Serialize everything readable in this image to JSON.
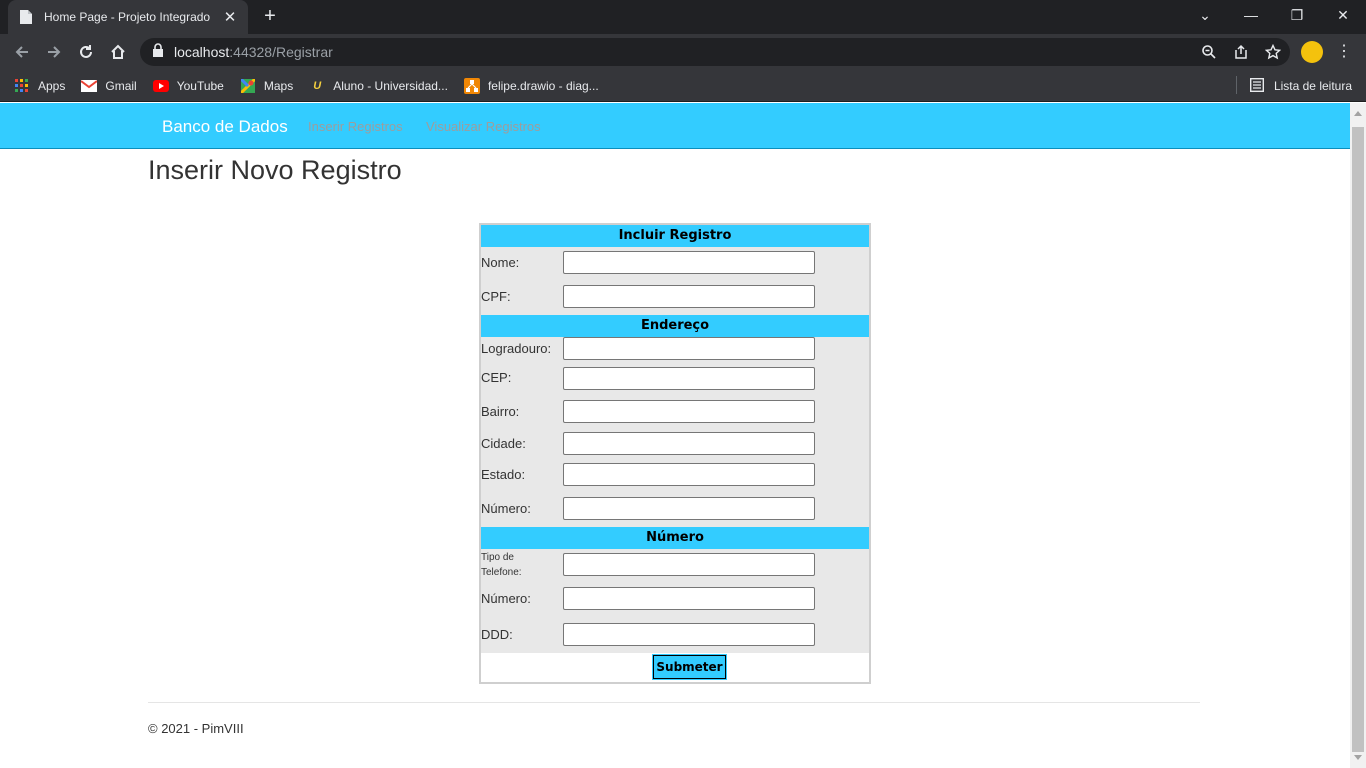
{
  "browser": {
    "tab_title": "Home Page - Projeto Integrado M",
    "url_host": "localhost",
    "url_rest": ":44328/Registrar",
    "bookmarks": [
      {
        "label": "Apps",
        "icon": "apps-grid-icon"
      },
      {
        "label": "Gmail",
        "icon": "gmail-icon"
      },
      {
        "label": "YouTube",
        "icon": "youtube-icon"
      },
      {
        "label": "Maps",
        "icon": "maps-icon"
      },
      {
        "label": "Aluno - Universidad...",
        "icon": "unip-icon"
      },
      {
        "label": "felipe.drawio - diag...",
        "icon": "drawio-icon"
      }
    ],
    "reading_list": "Lista de leitura"
  },
  "nav": {
    "brand": "Banco de Dados",
    "links": [
      "Inserir Registros",
      "Visualizar Registros"
    ]
  },
  "page": {
    "title": "Inserir Novo Registro"
  },
  "form": {
    "sections": [
      "Incluir Registro",
      "Endereço",
      "Número"
    ],
    "labels": {
      "nome": "Nome:",
      "cpf": "CPF:",
      "logradouro": "Logradouro:",
      "cep": "CEP:",
      "bairro": "Bairro:",
      "cidade": "Cidade:",
      "estado": "Estado:",
      "numero_end": "Número:",
      "tipo_telefone": "Tipo de Telefone:",
      "numero_tel": "Número:",
      "ddd": "DDD:"
    },
    "submit": "Submeter"
  },
  "footer": {
    "text": "© 2021 - PimVIII"
  },
  "colors": {
    "accent": "#33ccff",
    "form_bg": "#e8e8e8"
  }
}
